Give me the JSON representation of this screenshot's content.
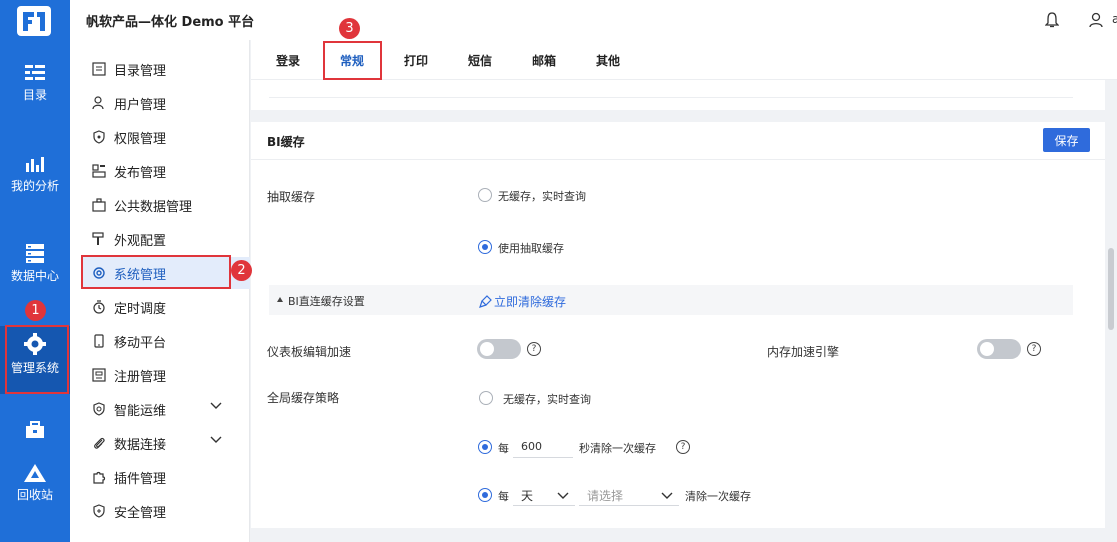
{
  "rail": {
    "items": [
      {
        "label": "目录"
      },
      {
        "label": "我的分析"
      },
      {
        "label": "数据中心"
      },
      {
        "label": "管理系统"
      },
      {
        "label": ""
      },
      {
        "label": "回收站"
      }
    ]
  },
  "header": {
    "title": "帆软产品—体化 Demo 平台",
    "user": "admin"
  },
  "sidebar": {
    "items": [
      {
        "label": "目录管理"
      },
      {
        "label": "用户管理"
      },
      {
        "label": "权限管理"
      },
      {
        "label": "发布管理"
      },
      {
        "label": "公共数据管理"
      },
      {
        "label": "外观配置"
      },
      {
        "label": "系统管理"
      },
      {
        "label": "定时调度"
      },
      {
        "label": "移动平台"
      },
      {
        "label": "注册管理"
      },
      {
        "label": "智能运维"
      },
      {
        "label": "数据连接"
      },
      {
        "label": "插件管理"
      },
      {
        "label": "安全管理"
      }
    ]
  },
  "tabs": [
    {
      "label": "登录"
    },
    {
      "label": "常规"
    },
    {
      "label": "打印"
    },
    {
      "label": "短信"
    },
    {
      "label": "邮箱"
    },
    {
      "label": "其他"
    }
  ],
  "bi": {
    "title": "BI缓存",
    "save": "保存",
    "extract_label": "抽取缓存",
    "extract_opt1": "无缓存，实时查询",
    "extract_opt2": "使用抽取缓存",
    "direct_header": "BI直连缓存设置",
    "clear_link": "立即清除缓存",
    "dashboard_accel": "仪表板编辑加速",
    "memory_engine": "内存加速引擎",
    "global_label": "全局缓存策略",
    "global_opt1": "无缓存，实时查询",
    "every": "每",
    "seconds_value": "600",
    "seconds_suffix": "秒清除一次缓存",
    "day_value": "天",
    "select_placeholder": "请选择",
    "clear_suffix": "清除一次缓存"
  },
  "annotations": [
    "1",
    "2",
    "3"
  ],
  "colors": {
    "rail": "#1f6fd8",
    "accent": "#2f6bdc",
    "annotation": "#e0353b"
  }
}
